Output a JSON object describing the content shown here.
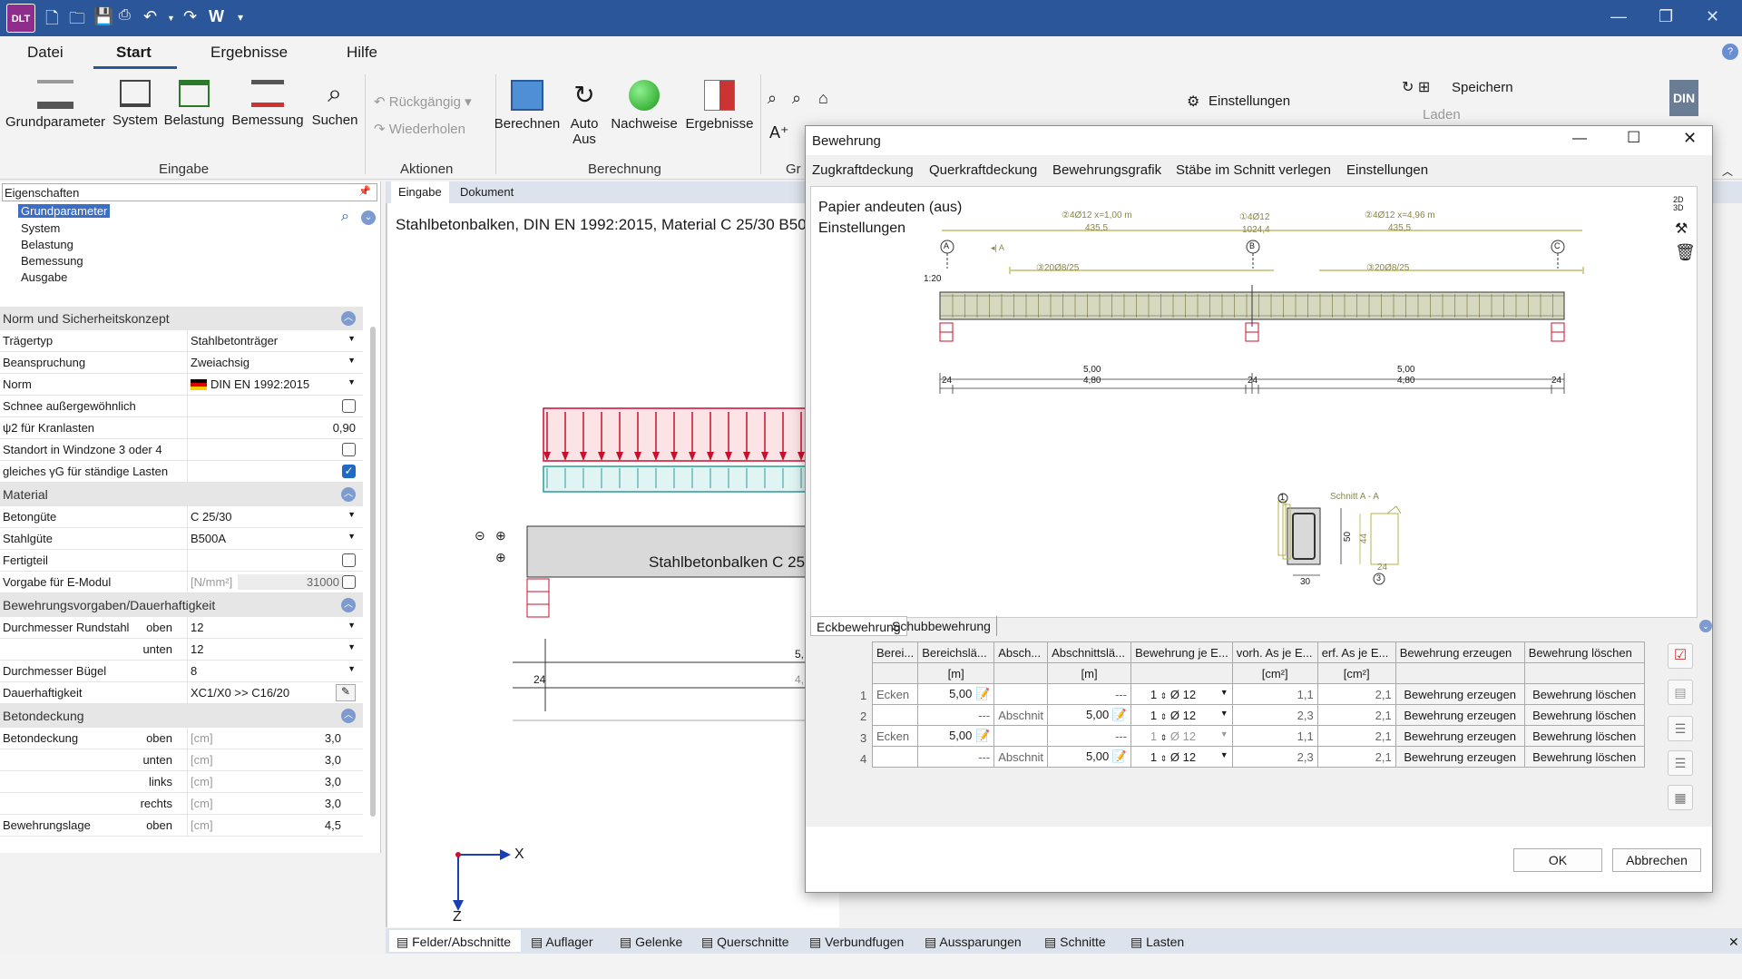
{
  "titlebar": {
    "logo": "DLT",
    "quick_w": "W",
    "icons": [
      "new-file-icon",
      "open-folder-icon",
      "save-icon",
      "print-icon",
      "undo-icon",
      "redo-icon"
    ]
  },
  "menu": {
    "tabs": [
      "Datei",
      "Start",
      "Ergebnisse",
      "Hilfe"
    ],
    "active": "Start"
  },
  "ribbon": {
    "eingabe": {
      "buttons": [
        "Grundparameter",
        "System",
        "Belastung",
        "Bemessung",
        "Suchen"
      ],
      "group": "Eingabe"
    },
    "aktionen": {
      "undo": "Rückgängig",
      "redo": "Wiederholen",
      "group": "Aktionen"
    },
    "berechnung": {
      "berechnen": "Berechnen",
      "auto1": "Auto",
      "auto2": "Aus",
      "nachweise": "Nachweise",
      "ergebnisse": "Ergebnisse",
      "group": "Berechnung"
    },
    "gr": "Gr",
    "einstellungen": "Einstellungen",
    "speichern": "Speichern",
    "laden": "Laden",
    "din": "DIN"
  },
  "left": {
    "header": "Eigenschaften",
    "tree": [
      "Grundparameter",
      "System",
      "Belastung",
      "Bemessung",
      "Ausgabe"
    ],
    "sections": {
      "norm": "Norm und Sicherheitskonzept",
      "material": "Material",
      "bewehrung": "Bewehrungsvorgaben/Dauerhaftigkeit",
      "betondeckung": "Betondeckung"
    },
    "rows": {
      "traegertyp": {
        "label": "Trägertyp",
        "value": "Stahlbetonträger"
      },
      "beanspruchung": {
        "label": "Beanspruchung",
        "value": "Zweiachsig"
      },
      "norm": {
        "label": "Norm",
        "value": "DIN EN 1992:2015"
      },
      "schnee": {
        "label": "Schnee außergewöhnlich"
      },
      "psi2": {
        "label": "ψ2 für Kranlasten",
        "value": "0,90"
      },
      "windzone": {
        "label": "Standort in Windzone 3 oder 4"
      },
      "gammaG": {
        "label": "gleiches γG für ständige Lasten"
      },
      "betonguete": {
        "label": "Betongüte",
        "value": "C 25/30"
      },
      "stahlguete": {
        "label": "Stahlgüte",
        "value": "B500A"
      },
      "fertigteil": {
        "label": "Fertigteil"
      },
      "emodul": {
        "label": "Vorgabe für E-Modul",
        "unit": "[N/mm²]",
        "value": "31000"
      },
      "rund_oben": {
        "label": "Durchmesser Rundstahl",
        "sub": "oben",
        "value": "12"
      },
      "rund_unten": {
        "sub": "unten",
        "value": "12"
      },
      "buegel": {
        "label": "Durchmesser Bügel",
        "value": "8"
      },
      "dauer": {
        "label": "Dauerhaftigkeit",
        "value": "XC1/X0 >> C16/20"
      },
      "bd_oben": {
        "label": "Betondeckung",
        "sub": "oben",
        "unit": "[cm]",
        "value": "3,0"
      },
      "bd_unten": {
        "sub": "unten",
        "unit": "[cm]",
        "value": "3,0"
      },
      "bd_links": {
        "sub": "links",
        "unit": "[cm]",
        "value": "3,0"
      },
      "bd_rechts": {
        "sub": "rechts",
        "unit": "[cm]",
        "value": "3,0"
      },
      "blage": {
        "label": "Bewehrungslage",
        "sub": "oben",
        "unit": "[cm]",
        "value": "4,5"
      }
    }
  },
  "doc": {
    "tabs": [
      "Eingabe",
      "Dokument"
    ],
    "title": "Stahlbetonbalken, DIN EN 1992:2015, Material C 25/30 B50",
    "beam_label": "Stahlbetonbalken C 25",
    "dim_24": "24",
    "dim_5": "5,",
    "dim_4": "4,",
    "axis_x": "X",
    "axis_z": "Z"
  },
  "bottom_tabs": [
    "Felder/Abschnitte",
    "Auflager",
    "Gelenke",
    "Querschnitte",
    "Verbundfugen",
    "Aussparungen",
    "Schnitte",
    "Lasten"
  ],
  "dialog": {
    "title": "Bewehrung",
    "menu": [
      "Zugkraftdeckung",
      "Querkraftdeckung",
      "Bewehrungsgrafik",
      "Stäbe im Schnitt verlegen",
      "Einstellungen"
    ],
    "drawing": {
      "line1": "Papier andeuten (aus)",
      "line2": "Einstellungen",
      "bar1": "4Ø12 x=1,00 m",
      "bar1_len": "435,5",
      "bar2": "4Ø12",
      "bar2_len": "1024,4",
      "bar3": "4Ø12 x=4,96 m",
      "bar3_len": "435,5",
      "stirrup": "20Ø8/25",
      "scale": "1:20",
      "axisA": "A",
      "axisB": "B",
      "axisC": "C",
      "sectionA": "A",
      "span1": "5,00",
      "span1b": "4,80",
      "span2": "5,00",
      "span2b": "4,80",
      "support": "24",
      "schnitt": "Schnitt A - A",
      "h50": "50",
      "w30": "30",
      "h44": "44",
      "w24": "24",
      "n1": "1",
      "n2": "2",
      "n3": "3"
    },
    "tabs": [
      "Eckbewehrung",
      "Schubbewehrung"
    ],
    "table": {
      "headers": [
        "Berei...",
        "Bereichslä...",
        "Absch...",
        "Abschnittslä...",
        "Bewehrung je E...",
        "vorh. As je E...",
        "erf. As je E...",
        "Bewehrung erzeugen",
        "Bewehrung löschen"
      ],
      "units": [
        "",
        "[m]",
        "",
        "[m]",
        "",
        "[cm²]",
        "[cm²]",
        "",
        ""
      ],
      "rows": [
        {
          "n": "1",
          "bereich": "Ecken",
          "blen": "5,00",
          "absch": "",
          "alen": "---",
          "count": "1",
          "dia": "Ø 12",
          "vorh": "1,1",
          "erf": "2,1",
          "erz": "Bewehrung erzeugen",
          "del": "Bewehrung löschen"
        },
        {
          "n": "2",
          "bereich": "",
          "blen": "---",
          "absch": "Abschnit",
          "alen": "5,00",
          "count": "1",
          "dia": "Ø 12",
          "vorh": "2,3",
          "erf": "2,1",
          "erz": "Bewehrung erzeugen",
          "del": "Bewehrung löschen"
        },
        {
          "n": "3",
          "bereich": "Ecken",
          "blen": "5,00",
          "absch": "",
          "alen": "---",
          "count": "1",
          "dia": "Ø 12",
          "vorh": "1,1",
          "erf": "2,1",
          "erz": "Bewehrung erzeugen",
          "del": "Bewehrung löschen"
        },
        {
          "n": "4",
          "bereich": "",
          "blen": "---",
          "absch": "Abschnit",
          "alen": "5,00",
          "count": "1",
          "dia": "Ø 12",
          "vorh": "2,3",
          "erf": "2,1",
          "erz": "Bewehrung erzeugen",
          "del": "Bewehrung löschen"
        }
      ]
    },
    "ok": "OK",
    "cancel": "Abbrechen",
    "side_icons": [
      "2d-3d-toggle-icon",
      "magic-wand-icon",
      "trash-icon"
    ]
  },
  "colors": {
    "titlebar": "#2b579a",
    "accent": "#2b579a",
    "load": "#c8102e",
    "rebar": "#b5b04a",
    "stirrup_axis": "#b5b04a",
    "concrete": "#d9d9d9"
  }
}
